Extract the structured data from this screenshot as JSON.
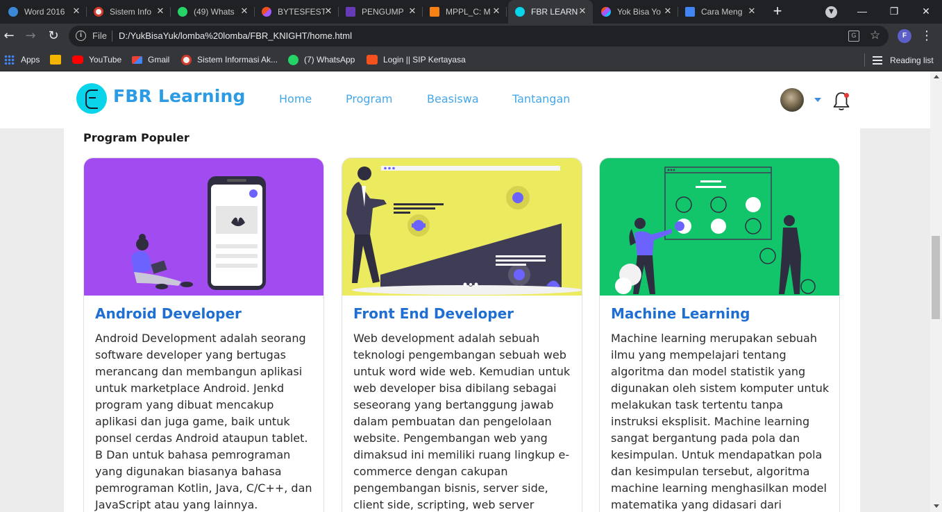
{
  "browser": {
    "tabs": [
      {
        "label": "Word 2016",
        "icon": "globe-icon",
        "color": "#3b88d8",
        "active": false
      },
      {
        "label": "Sistem Info",
        "icon": "sistem-info-icon",
        "color": "#d23b2c",
        "active": false
      },
      {
        "label": "(49) Whats",
        "icon": "whatsapp-icon",
        "color": "#25d366",
        "active": false
      },
      {
        "label": "BYTESFEST",
        "icon": "figma-icon",
        "color": "#f24e1e",
        "active": false
      },
      {
        "label": "PENGUMP",
        "icon": "forms-icon",
        "color": "#673ab7",
        "active": false
      },
      {
        "label": "MPPL_C: M",
        "icon": "moodle-icon",
        "color": "#f98012",
        "active": false
      },
      {
        "label": "FBR LEARN",
        "icon": "fbr-icon",
        "color": "#0ad4ea",
        "active": true
      },
      {
        "label": "Yok Bisa Yo",
        "icon": "figma-icon",
        "color": "#a259ff",
        "active": false
      },
      {
        "label": "Cara Meng",
        "icon": "bookmark-tab-icon",
        "color": "#4285f4",
        "active": false
      }
    ],
    "address": {
      "scheme_label": "File",
      "url": "D:/YukBisaYuk/lomba%20lomba/FBR_KNIGHT/home.html"
    },
    "profile_initial": "F",
    "bookmarks": [
      {
        "label": "Apps",
        "icon": "apps-icon"
      },
      {
        "label": "",
        "icon": "classroom-icon"
      },
      {
        "label": "YouTube",
        "icon": "youtube-icon"
      },
      {
        "label": "Gmail",
        "icon": "gmail-icon"
      },
      {
        "label": "Sistem Informasi Ak...",
        "icon": "sistem-info-icon"
      },
      {
        "label": "(7) WhatsApp",
        "icon": "whatsapp-icon"
      },
      {
        "label": "Login || SIP Kertayasa",
        "icon": "sip-icon"
      }
    ],
    "reading_list": "Reading list"
  },
  "site": {
    "logo_text": "FBR Learning",
    "nav": [
      "Home",
      "Program",
      "Beasiswa",
      "Tantangan"
    ],
    "notification_count": 1
  },
  "section": {
    "title": "Program Populer"
  },
  "cards": [
    {
      "title": "Android Developer",
      "image_bg": "#a24bf0",
      "text": "Android Development adalah seorang software developer yang bertugas merancang dan membangun aplikasi untuk marketplace Android. Jenkd program yang dibuat mencakup aplikasi dan juga game, baik untuk ponsel cerdas Android ataupun tablet. B Dan untuk bahasa pemrograman yang digunakan biasanya bahasa pemrograman Kotlin, Java, C/C++, dan JavaScript atau yang lainnya."
    },
    {
      "title": "Front End Developer",
      "image_bg": "#ecea5f",
      "text": "Web development adalah sebuah teknologi pengembangan sebuah web untuk word wide web. Kemudian untuk web developer bisa dibilang sebagai seseorang yang bertanggung jawab dalam pembuatan dan pengelolaan website. Pengembangan web yang dimaksud ini memiliki ruang lingkup e-commerce dengan cakupan pengembangan bisnis, server side, client side, scripting, web server"
    },
    {
      "title": "Machine Learning",
      "image_bg": "#12c46a",
      "text": "Machine learning merupakan sebuah ilmu yang mempelajari tentang algoritma dan model statistik yang digunakan oleh sistem komputer untuk melakukan task tertentu tanpa instruksi eksplisit. Machine learning sangat bergantung pada pola dan kesimpulan. Untuk mendapatkan pola dan kesimpulan tersebut, algoritma machine learning menghasilkan model matematika yang didasari dari"
    }
  ]
}
